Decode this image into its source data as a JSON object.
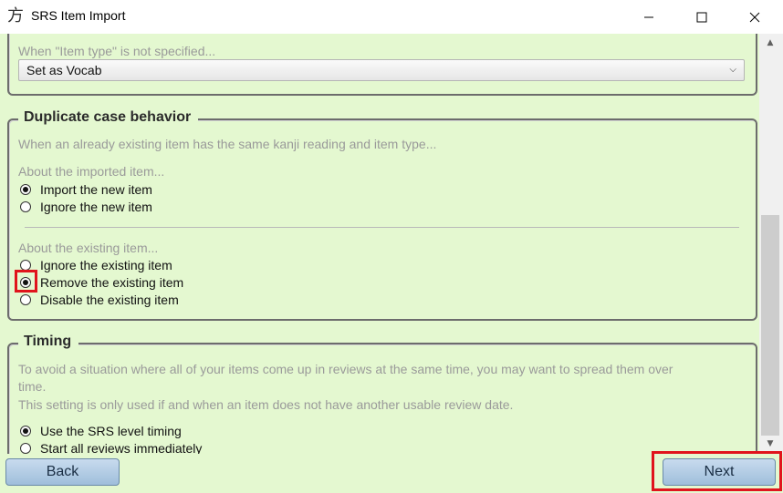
{
  "window": {
    "title": "SRS Item Import",
    "app_glyph": "方"
  },
  "item_type_group": {
    "hint": "When \"Item type\" is not specified...",
    "selected": "Set as Vocab"
  },
  "duplicate_group": {
    "title": "Duplicate case behavior",
    "description": "When an already existing item has the same kanji reading and item type...",
    "imported_label": "About the imported item...",
    "imported_options": [
      "Import the new item",
      "Ignore the new item"
    ],
    "imported_selected": 0,
    "existing_label": "About the existing item...",
    "existing_options": [
      "Ignore the existing item",
      "Remove the existing item",
      "Disable the existing item"
    ],
    "existing_selected": 1
  },
  "timing_group": {
    "title": "Timing",
    "desc_line1": "To avoid a situation where all of your items come up in reviews at the same time, you may want to spread them over",
    "desc_line2": "time.",
    "desc_line3": "This setting is only used if and when an item does not have another usable review date.",
    "options": [
      "Use the SRS level timing",
      "Start all reviews immediately"
    ],
    "selected": 0
  },
  "buttons": {
    "back": "Back",
    "next": "Next"
  },
  "colors": {
    "background": "#e4f8d0",
    "highlight": "#e0141c",
    "button": "#b4cde6"
  }
}
